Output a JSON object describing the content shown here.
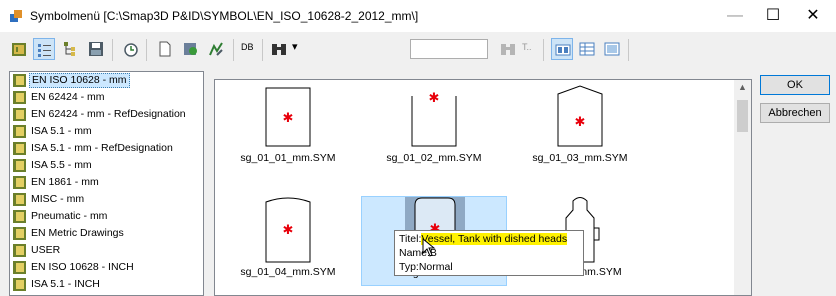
{
  "window": {
    "title": "Symbolmenü [C:\\Smap3D P&ID\\SYMBOL\\EN_ISO_10628-2_2012_mm\\]",
    "minimize_glyph": "—",
    "maximize_glyph": "☐",
    "close_glyph": "✕"
  },
  "toolbar": {
    "db_label": "DB",
    "dropdown_glyph": "▾",
    "t_label": "T..",
    "search_value": ""
  },
  "tree": {
    "items": [
      {
        "label": "EN ISO 10628 - mm",
        "selected": true
      },
      {
        "label": "EN 62424 - mm"
      },
      {
        "label": "EN 62424 - mm - RefDesignation"
      },
      {
        "label": "ISA 5.1 - mm"
      },
      {
        "label": "ISA 5.1 - mm - RefDesignation"
      },
      {
        "label": "ISA 5.5 - mm"
      },
      {
        "label": "EN 1861 - mm"
      },
      {
        "label": "MISC - mm"
      },
      {
        "label": "Pneumatic - mm"
      },
      {
        "label": "EN Metric Drawings"
      },
      {
        "label": "USER"
      },
      {
        "label": "EN ISO 10628 - INCH"
      },
      {
        "label": "ISA 5.1 - INCH"
      }
    ]
  },
  "gallery": {
    "symbols": [
      {
        "label": "sg_01_01_mm.SYM"
      },
      {
        "label": "sg_01_02_mm.SYM"
      },
      {
        "label": "sg_01_03_mm.SYM"
      },
      {
        "label": "sg_01_04_mm.SYM"
      },
      {
        "label": "sg",
        "selected": true
      },
      {
        "label": "mm.SYM"
      }
    ],
    "marker_glyph": "✱"
  },
  "tooltip": {
    "title_label": "Titel:",
    "title_value": "Vessel, Tank with dished heads",
    "name_line": "Name:B",
    "type_line": "Typ:Normal"
  },
  "buttons": {
    "ok": "OK",
    "cancel": "Abbrechen"
  },
  "colors": {
    "accent": "#0078d7",
    "selection": "#cce8ff",
    "marker": "#e8000b",
    "tooltip_highlight": "#fff200"
  }
}
